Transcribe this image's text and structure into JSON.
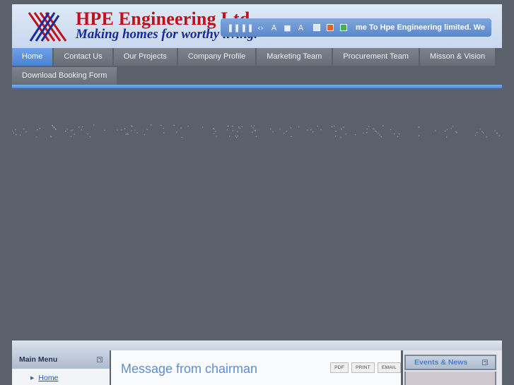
{
  "header": {
    "logo_title": "HPE Engineering Ltd",
    "logo_slogan": "Making homes for worthy living.",
    "marquee": "me To Hpe Engineering limited. We",
    "swatches": [
      "#d7e6f6",
      "#e2622b",
      "#3db54a"
    ],
    "tools": [
      "pause-icon",
      "pause-icon",
      "code-icon",
      "font-size-icon",
      "square-icon",
      "font-icon"
    ]
  },
  "nav": {
    "row1": [
      "Home",
      "Contact Us",
      "Our Projects",
      "Company Profile",
      "Marketing Team",
      "Procurement Team",
      "Misson & Vision"
    ],
    "row2": [
      "Download Booking Form"
    ],
    "active": "Home"
  },
  "sidebar": {
    "title": "Main Menu",
    "links": [
      "Home"
    ]
  },
  "article": {
    "title": "Message from chairman",
    "buttons": [
      "PDF",
      "PRINT",
      "EMAIL"
    ]
  },
  "right": {
    "title": "Events & News"
  },
  "colors": {
    "accent": "#4c82d0",
    "background": "#5a616b",
    "title_red": "#c0101b",
    "slogan_blue": "#1a2a9a"
  }
}
